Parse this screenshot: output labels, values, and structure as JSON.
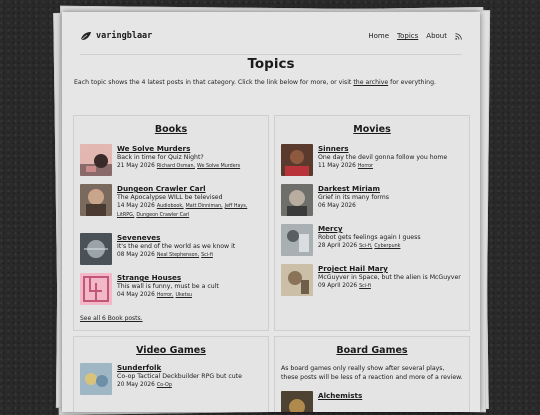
{
  "brand": {
    "name": "varingblaar"
  },
  "nav": {
    "home": "Home",
    "topics": "Topics",
    "about": "About"
  },
  "page": {
    "title": "Topics",
    "intro_before": "Each topic shows the 4 latest posts in that category. Click the link below for more, or visit ",
    "intro_link": "the archive",
    "intro_after": " for everything."
  },
  "books": {
    "heading": "Books",
    "see_all": "See all 6 Book posts.",
    "items": [
      {
        "title": "We Solve Murders",
        "desc": "Back in time for Quiz Night?",
        "date": "21 May 2026",
        "tags": [
          "Richard Osman,",
          "We Solve Murders"
        ]
      },
      {
        "title": "Dungeon Crawler Carl",
        "desc": "The Apocalypse WILL be televised",
        "date": "14 May 2026",
        "tags": [
          "Audiobook,",
          "Matt Dinniman,",
          "Jeff Hays,",
          "LitRPG,",
          "Dungeon Crawler Carl"
        ]
      },
      {
        "title": "Seveneves",
        "desc": "It's the end of the world as we know it",
        "date": "08 May 2026",
        "tags": [
          "Neal Stephenson,",
          "Sci-fi"
        ]
      },
      {
        "title": "Strange Houses",
        "desc": "This wall is funny, must be a cult",
        "date": "04 May 2026",
        "tags": [
          "Horror,",
          "Uketsu"
        ]
      }
    ]
  },
  "movies": {
    "heading": "Movies",
    "items": [
      {
        "title": "Sinners",
        "desc": "One day the devil gonna follow you home",
        "date": "11 May 2026",
        "tags": [
          "Horror"
        ]
      },
      {
        "title": "Darkest Miriam",
        "desc": "Grief in its many forms",
        "date": "06 May 2026",
        "tags": []
      },
      {
        "title": "Mercy",
        "desc": "Robot gets feelings again I guess",
        "date": "28 April 2026",
        "tags": [
          "Sci-fi,",
          "Cyberpunk"
        ]
      },
      {
        "title": "Project Hail Mary",
        "desc": "McGuyver in Space, but the alien is McGuyver",
        "date": "09 April 2026",
        "tags": [
          "Sci-fi"
        ]
      }
    ]
  },
  "videogames": {
    "heading": "Video Games",
    "items": [
      {
        "title": "Sunderfolk",
        "desc": "Co-op Tactical Deckbuilder RPG but cute",
        "date": "20 May 2026",
        "tags": [
          "Co-Op"
        ]
      }
    ]
  },
  "boardgames": {
    "heading": "Board Games",
    "intro": "As board games only really show after several plays, these posts will be less of a reaction and more of a review.",
    "items": [
      {
        "title": "Alchemists"
      }
    ]
  }
}
